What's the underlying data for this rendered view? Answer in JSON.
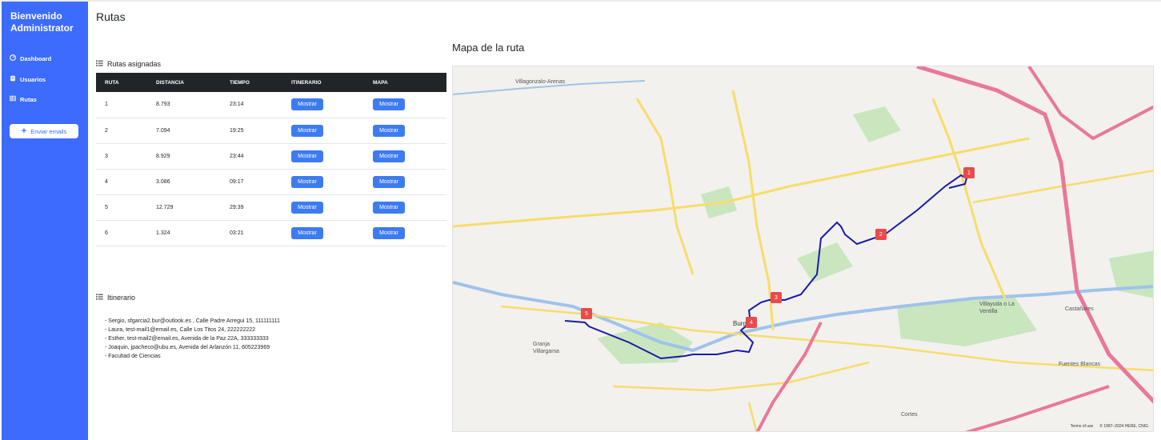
{
  "sidebar": {
    "welcome": "Bienvenido Administrator",
    "items": [
      {
        "label": "Dashboard",
        "icon": "dashboard-icon"
      },
      {
        "label": "Usuarios",
        "icon": "users-icon"
      },
      {
        "label": "Rutas",
        "icon": "table-icon"
      }
    ],
    "email_button": "Enviar emails"
  },
  "page": {
    "title": "Rutas"
  },
  "routes": {
    "heading": "Rutas asignadas",
    "columns": [
      "RUTA",
      "DISTANCIA",
      "TIEMPO",
      "ITINERARIO",
      "MAPA"
    ],
    "rows": [
      {
        "ruta": "1",
        "distancia": "8.793",
        "tiempo": "23:14"
      },
      {
        "ruta": "2",
        "distancia": "7.094",
        "tiempo": "19:25"
      },
      {
        "ruta": "3",
        "distancia": "8.929",
        "tiempo": "23:44"
      },
      {
        "ruta": "4",
        "distancia": "3.086",
        "tiempo": "09:17"
      },
      {
        "ruta": "5",
        "distancia": "12.729",
        "tiempo": "29:39"
      },
      {
        "ruta": "6",
        "distancia": "1.324",
        "tiempo": "03:21"
      }
    ],
    "button_label": "Mostrar"
  },
  "itinerary": {
    "heading": "Itinerario",
    "items": [
      "- Sergio, sfgarcia2.bur@outlook.es , Calle Padre Arregui 15, 111111111",
      "- Laura, test-mail1@email.es, Calle Los Titos 24, 222222222",
      "- Esther, test-mail2@email.es, Avenida de la Paz 22A, 333333333",
      "- Joaquin, jpacheco@ubu.es, Avenida del Arlanzón 11, 605223969",
      "- Facultad de Ciencias"
    ]
  },
  "map": {
    "title": "Mapa de la ruta",
    "markers": [
      "1",
      "2",
      "3",
      "4",
      "5"
    ],
    "places": [
      "Villagonzalo-Arenas",
      "Granja Villargama",
      "Castañares",
      "Fuentes Blancas",
      "Villayuda o La Ventilla",
      "Cortes",
      "Burgos"
    ],
    "attribution_terms": "Terms of use",
    "attribution_copy": "© 1987–2024 HERE, CNIG",
    "colors": {
      "route": "#1a1aa8",
      "marker": "#e84b4b",
      "highway": "#e8789a",
      "main_road": "#f7dd6a",
      "park": "#c9e6bf",
      "river": "#9fc3ea"
    }
  }
}
